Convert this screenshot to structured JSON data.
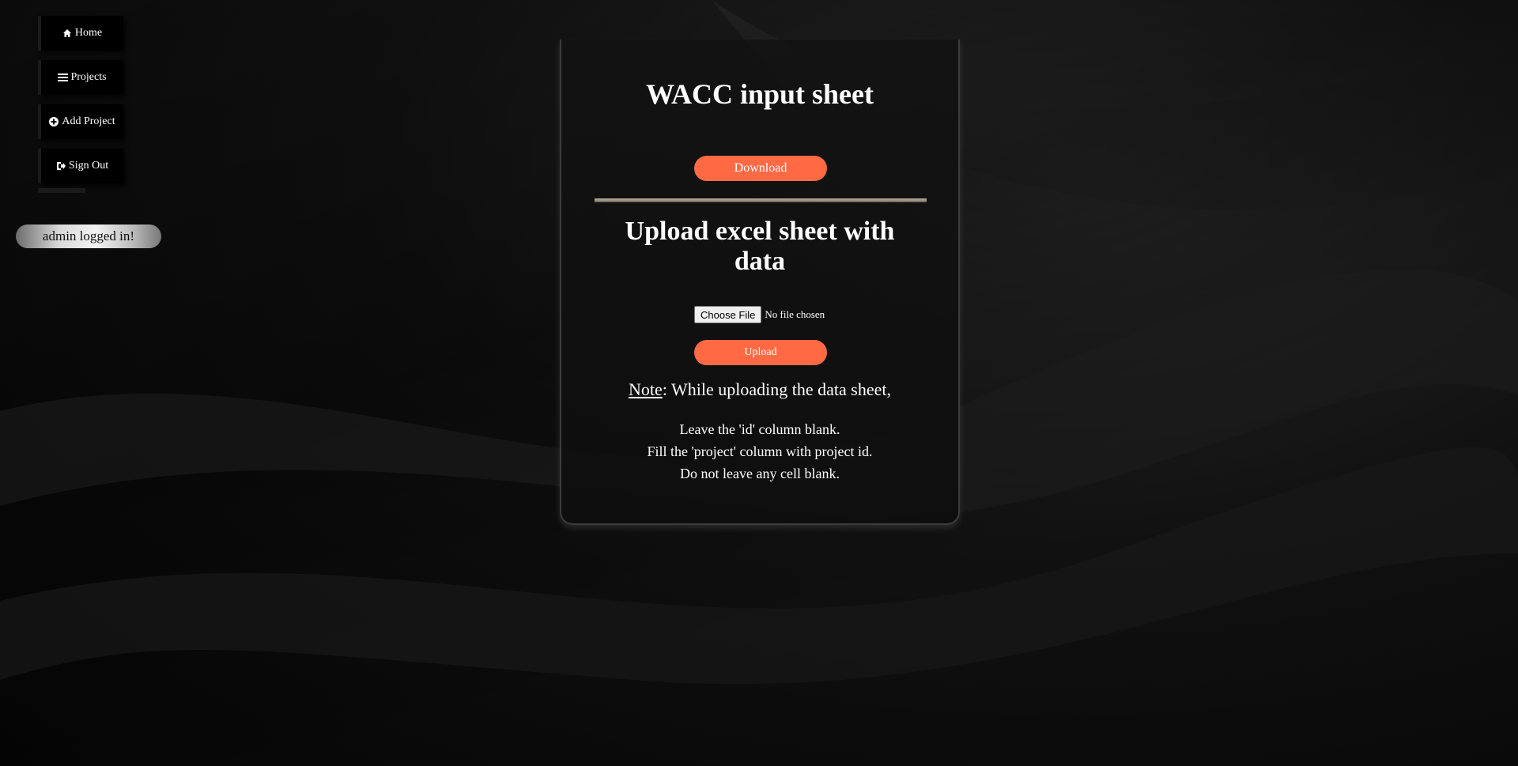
{
  "sidebar": {
    "items": [
      {
        "label": "Home",
        "icon": "home-icon"
      },
      {
        "label": "Projects",
        "icon": "list-icon"
      },
      {
        "label": "Add Project",
        "icon": "plus-circle-icon"
      },
      {
        "label": "Sign Out",
        "icon": "sign-out-icon"
      }
    ],
    "status": "admin logged in!"
  },
  "card": {
    "title": "WACC input sheet",
    "download_label": "Download",
    "upload_heading": "Upload excel sheet with data",
    "file_input": {
      "button_label": "Choose File",
      "status": "No file chosen"
    },
    "upload_label": "Upload",
    "note": {
      "label": "Note",
      "text": ": While uploading the data sheet,",
      "lines": [
        "Leave the 'id' column blank.",
        "Fill the 'project' column with project id.",
        "Do not leave any cell blank."
      ]
    }
  },
  "colors": {
    "accent": "#ff6a45",
    "background": "#0b0b0b"
  }
}
